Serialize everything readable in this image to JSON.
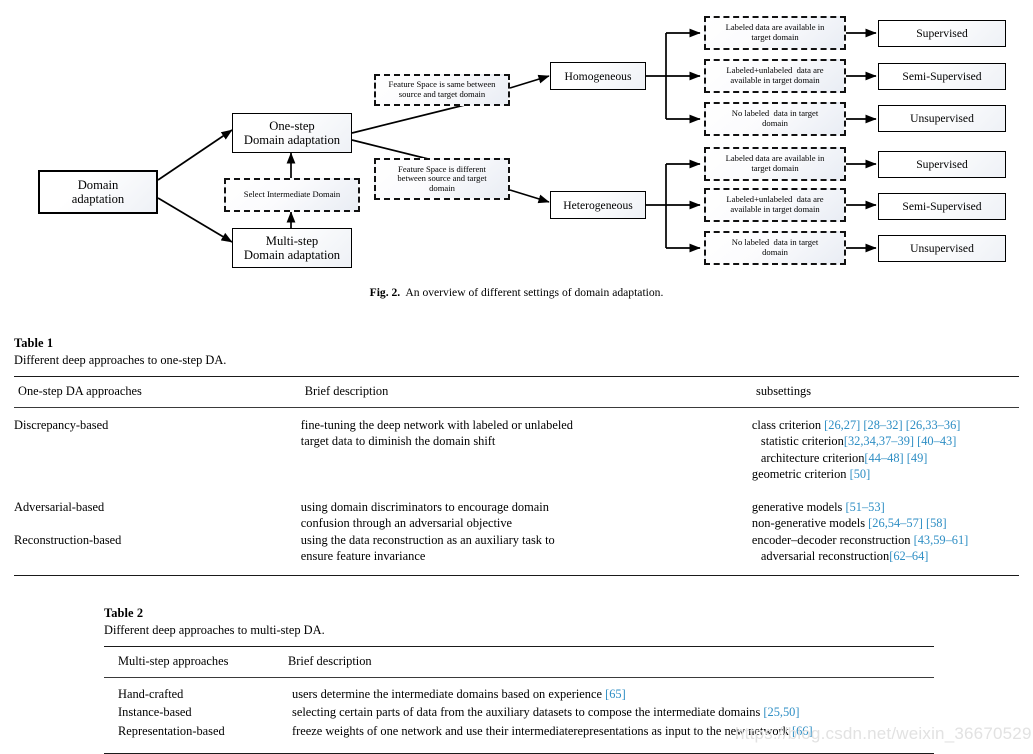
{
  "figure": {
    "caption_label": "Fig. 2.",
    "caption_text": "An overview of different settings of domain adaptation.",
    "nodes": {
      "root": "Domain\nadaptation",
      "one_step": "One-step\nDomain adaptation",
      "multi_step": "Multi-step\nDomain adaptation",
      "select_intermediate": "Select Intermediate Domain",
      "fs_same": "Feature Space is same between\nsource and target domain",
      "fs_diff": "Feature Space is different\nbetween source and target\ndomain",
      "homogeneous": "Homogeneous",
      "heterogeneous": "Heterogeneous",
      "labeled_1": "Labeled data are available in\ntarget domain",
      "labeled_unlabeled_1": "Labeled+unlabeled  data are\navailable in target domain",
      "no_labeled_1": "No labeled  data in target\ndomain",
      "labeled_2": "Labeled data are available in\ntarget domain",
      "labeled_unlabeled_2": "Labeled+unlabeled  data are\navailable in target domain",
      "no_labeled_2": "No labeled  data in target\ndomain",
      "supervised_1": "Supervised",
      "semi_supervised_1": "Semi-Supervised",
      "unsupervised_1": "Unsupervised",
      "supervised_2": "Supervised",
      "semi_supervised_2": "Semi-Supervised",
      "unsupervised_2": "Unsupervised"
    }
  },
  "table1": {
    "title": "Table 1",
    "subtitle": "Different deep approaches to one-step DA.",
    "headers": [
      "One-step DA approaches",
      "Brief description",
      "subsettings"
    ],
    "rows": [
      {
        "approach": "Discrepancy-based",
        "description": "fine-tuning the deep network with labeled or unlabeled\ntarget data to diminish the domain shift",
        "description_lines": [
          "fine-tuning the deep network with labeled or unlabeled",
          "target data to diminish the domain shift"
        ],
        "subsettings": [
          {
            "text": "class criterion ",
            "refs": "[26,27] [28–32] [26,33–36]",
            "indent": 0
          },
          {
            "text": "statistic criterion ",
            "refs": "[32,34,37–39] [40–43]",
            "indent": 1
          },
          {
            "text": "architecture criterion ",
            "refs": "[44–48] [49]",
            "indent": 1
          },
          {
            "text": "geometric criterion ",
            "refs": "[50]",
            "indent": 0
          }
        ]
      },
      {
        "approach": "Adversarial-based",
        "description_lines": [
          "using domain discriminators to encourage domain",
          "confusion through an adversarial objective"
        ],
        "subsettings": [
          {
            "text": "generative models ",
            "refs": "[51–53]",
            "indent": 0
          },
          {
            "text": "non-generative models ",
            "refs": "[26,54–57] [58]",
            "indent": 0
          }
        ]
      },
      {
        "approach": "Reconstruction-based",
        "description_lines": [
          "using the data reconstruction as an auxiliary task to",
          "ensure feature invariance"
        ],
        "subsettings": [
          {
            "text": "encoder–decoder reconstruction ",
            "refs": "[43,59–61]",
            "indent": 0
          },
          {
            "text": "adversarial reconstruction ",
            "refs": "[62–64]",
            "indent": 1
          }
        ]
      }
    ]
  },
  "table2": {
    "title": "Table 2",
    "subtitle": "Different deep approaches to multi-step DA.",
    "headers": [
      "Multi-step approaches",
      "Brief description"
    ],
    "rows": [
      {
        "approach": "Hand-crafted",
        "description": "users determine the intermediate domains based on experience ",
        "refs": "[65]"
      },
      {
        "approach": "Instance-based",
        "description": "selecting certain parts of data from the auxiliary datasets to compose the intermediate domains ",
        "refs": "[25,50]"
      },
      {
        "approach": "Representation-based",
        "description": "freeze weights of one network and use their intermediaterepresentations as input to the new network ",
        "refs": "[66]"
      }
    ]
  },
  "watermark": {
    "text": "https://blog.csdn.net/weixin_36670529"
  },
  "colors": {
    "reference_link": "#2e8ec4",
    "rule": "#1a1a1a",
    "watermark": "#e2e2e2"
  }
}
